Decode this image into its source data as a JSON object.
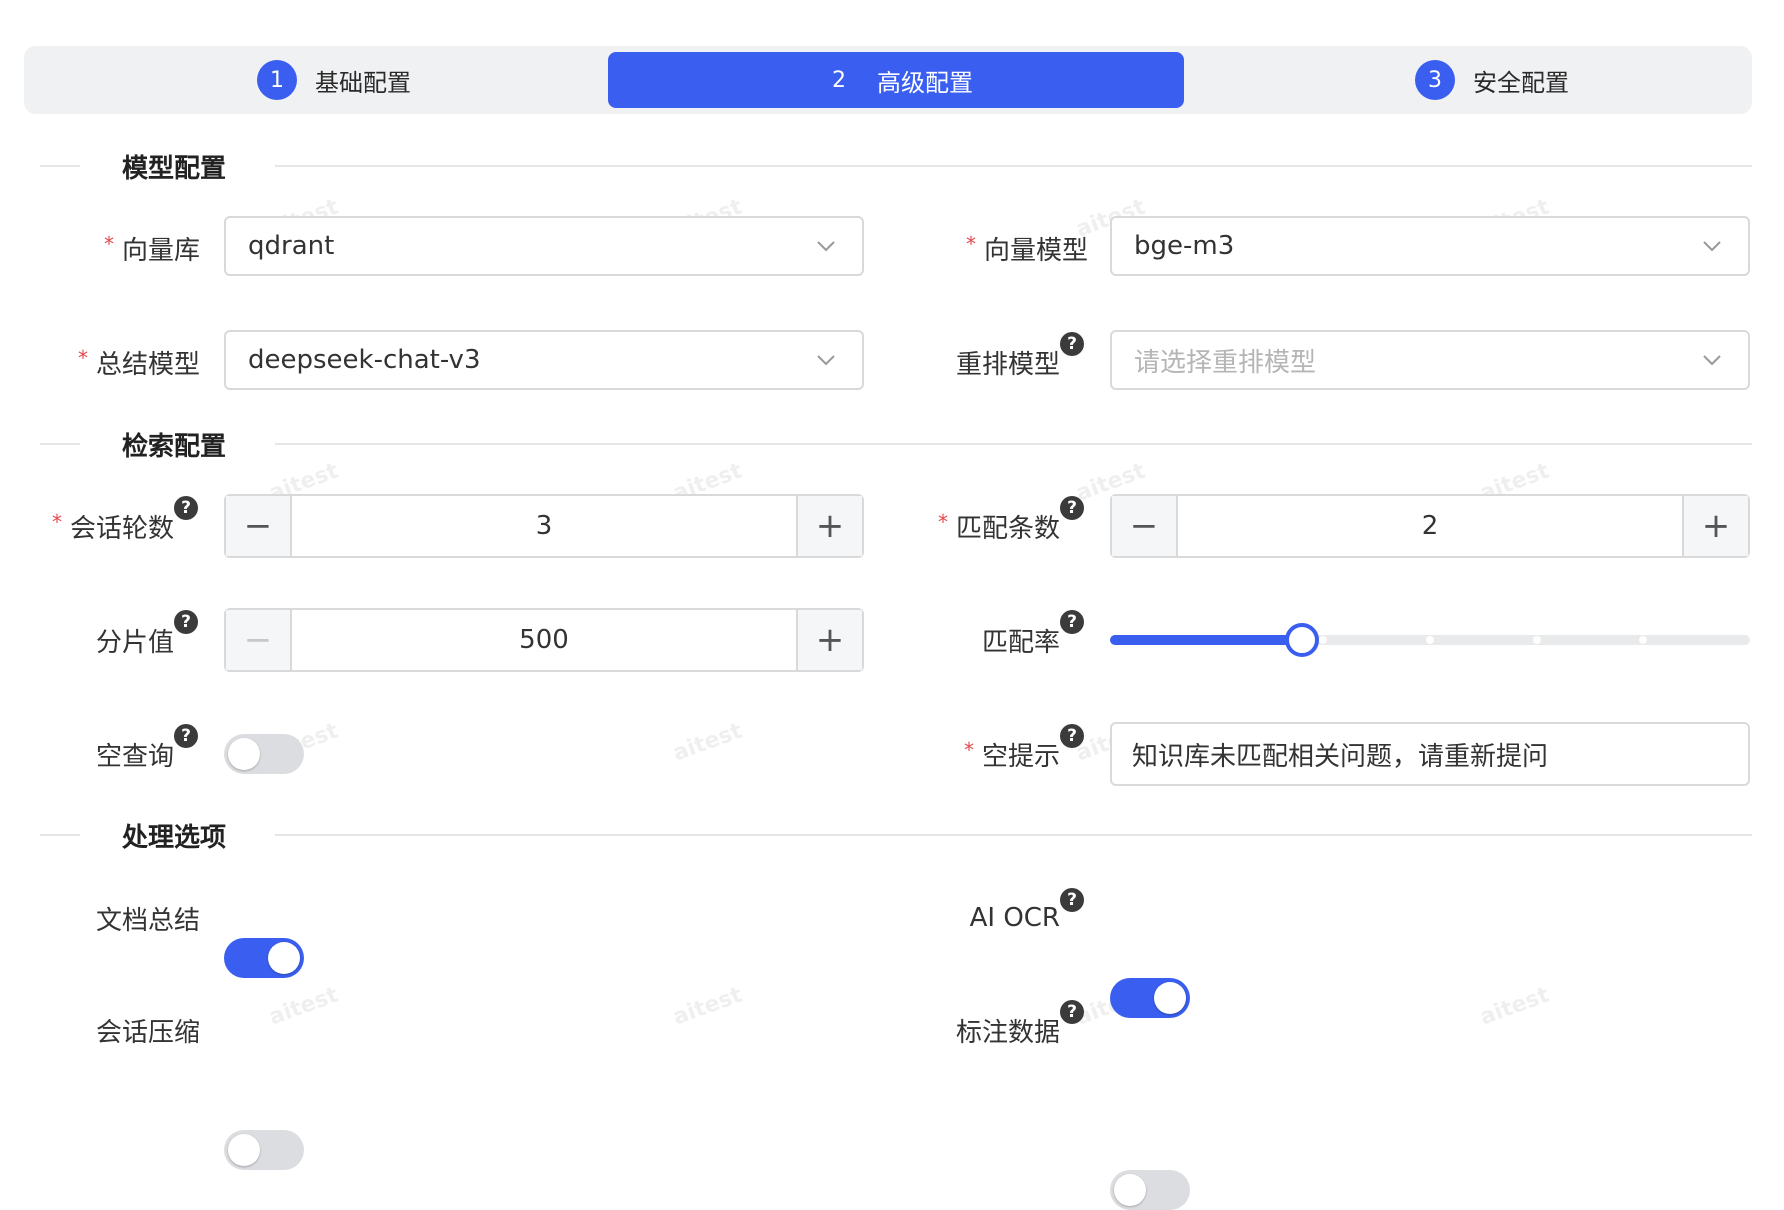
{
  "steps": [
    {
      "num": "1",
      "label": "基础配置",
      "active": false
    },
    {
      "num": "2",
      "label": "高级配置",
      "active": true
    },
    {
      "num": "3",
      "label": "安全配置",
      "active": false
    }
  ],
  "sections": {
    "model": "模型配置",
    "retrieval": "检索配置",
    "processing": "处理选项"
  },
  "model_config": {
    "vector_db": {
      "label": "向量库",
      "value": "qdrant"
    },
    "vector_model": {
      "label": "向量模型",
      "value": "bge-m3"
    },
    "summary_model": {
      "label": "总结模型",
      "value": "deepseek-chat-v3"
    },
    "rerank_model": {
      "label": "重排模型",
      "placeholder": "请选择重排模型"
    }
  },
  "retrieval_config": {
    "session_rounds": {
      "label": "会话轮数",
      "value": "3",
      "minus": "−",
      "plus": "+"
    },
    "match_count": {
      "label": "匹配条数",
      "value": "2",
      "minus": "−",
      "plus": "+"
    },
    "chunk_size": {
      "label": "分片值",
      "value": "500",
      "minus": "−",
      "plus": "+"
    },
    "match_rate": {
      "label": "匹配率",
      "value_fraction": 0.3,
      "steps": 7
    },
    "empty_query": {
      "label": "空查询",
      "enabled": false
    },
    "empty_hint": {
      "label": "空提示",
      "value": "知识库未匹配相关问题，请重新提问"
    }
  },
  "processing_options": {
    "doc_summary": {
      "label": "文档总结",
      "enabled": true
    },
    "ai_ocr": {
      "label": "AI OCR",
      "enabled": true
    },
    "session_compress": {
      "label": "会话压缩",
      "enabled": false
    },
    "annotated_data": {
      "label": "标注数据",
      "enabled": false
    }
  },
  "required_mark": "*",
  "help_mark": "?",
  "watermark": "aitest",
  "colors": {
    "primary": "#3a5ff0",
    "required": "#e5484d"
  }
}
